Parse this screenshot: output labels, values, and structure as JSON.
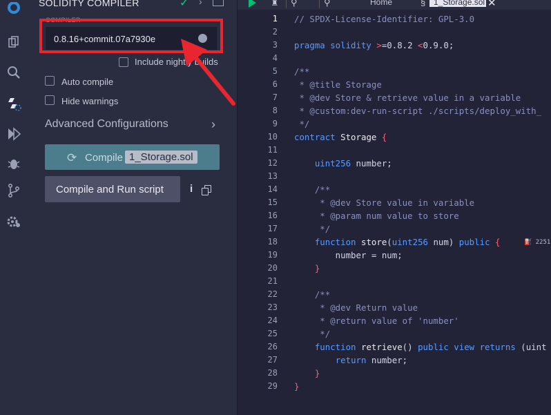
{
  "panel": {
    "title": "SOLIDITY COMPILER",
    "compiler_label": "COMPILER",
    "version": "0.8.16+commit.07a7930e",
    "nightly_label": "Include nightly builds",
    "auto_compile_label": "Auto compile",
    "hide_warnings_label": "Hide warnings",
    "advanced_label": "Advanced Configurations",
    "compile_prefix": "Compile",
    "compile_file": "1_Storage.sol",
    "run_label": "Compile and Run script"
  },
  "topbar": {
    "home_label": "Home",
    "tab_label": "1_Storage.sol"
  },
  "editor": {
    "lines": [
      [
        [
          "t-com",
          "// SPDX-License-Identifier: GPL-3.0"
        ]
      ],
      [],
      [
        [
          "t-kw",
          "pragma solidity "
        ],
        [
          "t-op",
          ">"
        ],
        [
          "",
          "=0.8.2 "
        ],
        [
          "t-op",
          "<"
        ],
        [
          "",
          "0.9.0;"
        ]
      ],
      [],
      [
        [
          "t-com",
          "/**"
        ]
      ],
      [
        [
          "t-com",
          " * @title Storage"
        ]
      ],
      [
        [
          "t-com",
          " * @dev Store & retrieve value in a variable"
        ]
      ],
      [
        [
          "t-com",
          " * @custom:dev-run-script ./scripts/deploy_with_"
        ]
      ],
      [
        [
          "t-com",
          " */"
        ]
      ],
      [
        [
          "t-kw",
          "contract "
        ],
        [
          "t-fn",
          "Storage "
        ],
        [
          "t-op",
          "{"
        ]
      ],
      [],
      [
        [
          "",
          "    "
        ],
        [
          "t-kw",
          "uint256 "
        ],
        [
          "",
          "number;"
        ]
      ],
      [],
      [
        [
          "t-com",
          "    /**"
        ]
      ],
      [
        [
          "t-com",
          "     * @dev Store value in variable"
        ]
      ],
      [
        [
          "t-com",
          "     * @param num value to store"
        ]
      ],
      [
        [
          "t-com",
          "     */"
        ]
      ],
      [
        [
          "",
          "    "
        ],
        [
          "t-kw",
          "function "
        ],
        [
          "t-fn",
          "store"
        ],
        [
          "",
          "("
        ],
        [
          "t-kw",
          "uint256 "
        ],
        [
          "",
          "num) "
        ],
        [
          "t-kw",
          "public "
        ],
        [
          "t-op",
          "{"
        ]
      ],
      [
        [
          "",
          "        number = num;"
        ]
      ],
      [
        [
          "",
          "    "
        ],
        [
          "t-op",
          "}"
        ]
      ],
      [],
      [
        [
          "t-com",
          "    /**"
        ]
      ],
      [
        [
          "t-com",
          "     * @dev Return value"
        ]
      ],
      [
        [
          "t-com",
          "     * @return value of 'number'"
        ]
      ],
      [
        [
          "t-com",
          "     */"
        ]
      ],
      [
        [
          "",
          "    "
        ],
        [
          "t-kw",
          "function "
        ],
        [
          "t-fn",
          "retrieve"
        ],
        [
          "",
          "() "
        ],
        [
          "t-kw",
          "public view returns "
        ],
        [
          "",
          "(uint"
        ]
      ],
      [
        [
          "",
          "        "
        ],
        [
          "t-kw",
          "return "
        ],
        [
          "",
          "number;"
        ]
      ],
      [
        [
          "",
          "    "
        ],
        [
          "t-op",
          "}"
        ]
      ],
      [
        [
          "t-op",
          "}"
        ]
      ]
    ],
    "gas_hint": "2251"
  },
  "colors": {
    "accent_red": "#e8262f",
    "compile_button": "#4b7d8c",
    "success_green": "#00d27a"
  }
}
